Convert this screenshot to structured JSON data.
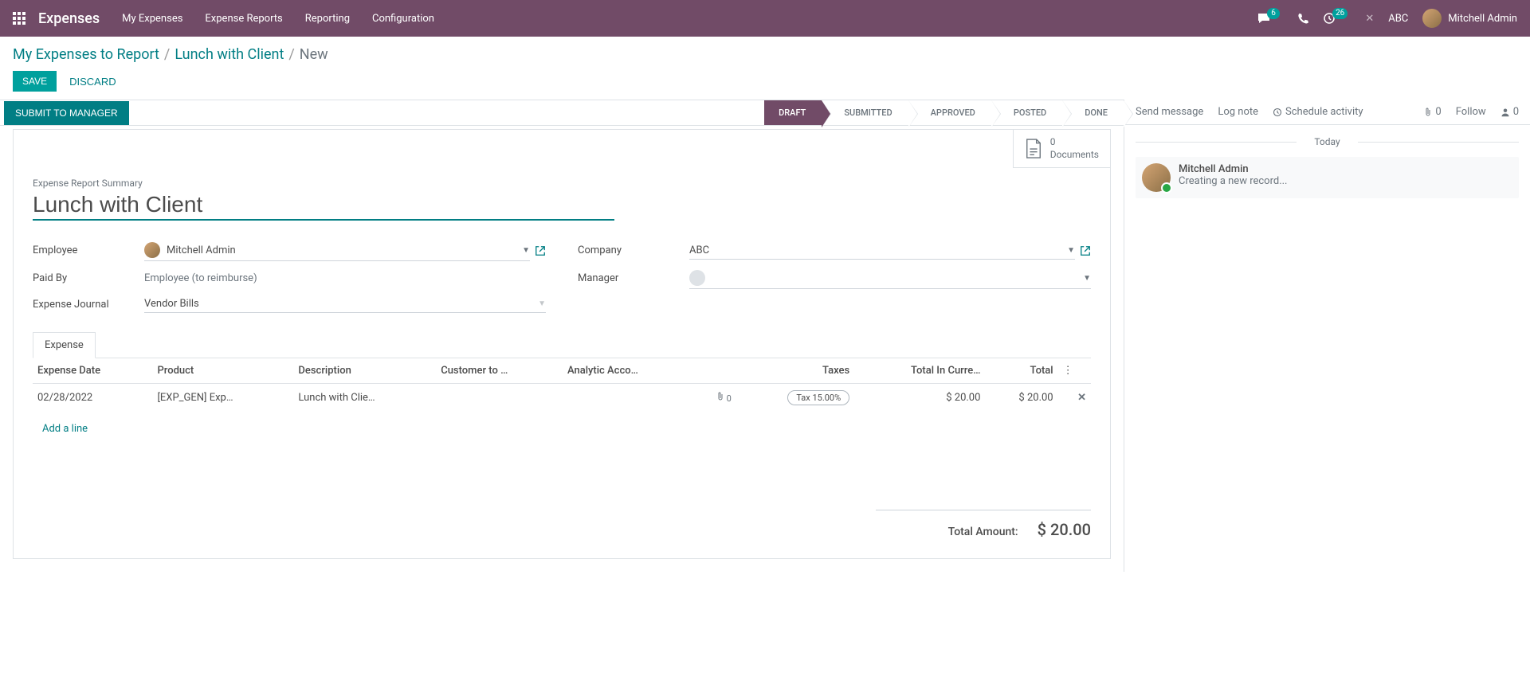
{
  "nav": {
    "brand": "Expenses",
    "items": [
      "My Expenses",
      "Expense Reports",
      "Reporting",
      "Configuration"
    ],
    "chat_badge": "6",
    "activity_badge": "26",
    "company": "ABC",
    "user": "Mitchell Admin"
  },
  "breadcrumb": {
    "root": "My Expenses to Report",
    "parent": "Lunch with Client",
    "current": "New"
  },
  "buttons": {
    "save": "SAVE",
    "discard": "DISCARD",
    "submit": "SUBMIT TO MANAGER"
  },
  "status_steps": [
    "DRAFT",
    "SUBMITTED",
    "APPROVED",
    "POSTED",
    "DONE"
  ],
  "documents": {
    "count": "0",
    "label": "Documents"
  },
  "form": {
    "summary_label": "Expense Report Summary",
    "summary_value": "Lunch with Client",
    "fields": {
      "employee_label": "Employee",
      "employee_value": "Mitchell Admin",
      "paidby_label": "Paid By",
      "paidby_value": "Employee (to reimburse)",
      "journal_label": "Expense Journal",
      "journal_value": "Vendor Bills",
      "company_label": "Company",
      "company_value": "ABC",
      "manager_label": "Manager",
      "manager_value": ""
    }
  },
  "tabs": {
    "expense": "Expense"
  },
  "table": {
    "headers": {
      "date": "Expense Date",
      "product": "Product",
      "description": "Description",
      "customer": "Customer to …",
      "analytic": "Analytic Acco…",
      "taxes": "Taxes",
      "total_curr": "Total In Curre…",
      "total": "Total"
    },
    "row": {
      "date": "02/28/2022",
      "product": "[EXP_GEN] Exp…",
      "description": "Lunch with Clie…",
      "attach_count": "0",
      "tax": "Tax 15.00%",
      "total_curr": "$ 20.00",
      "total": "$ 20.00"
    },
    "add_line": "Add a line"
  },
  "totals": {
    "label": "Total Amount:",
    "value": "$ 20.00"
  },
  "chatter": {
    "send": "Send message",
    "log": "Log note",
    "schedule": "Schedule activity",
    "attach_count": "0",
    "follow": "Follow",
    "follower_count": "0",
    "today": "Today",
    "msg_author": "Mitchell Admin",
    "msg_text": "Creating a new record..."
  }
}
